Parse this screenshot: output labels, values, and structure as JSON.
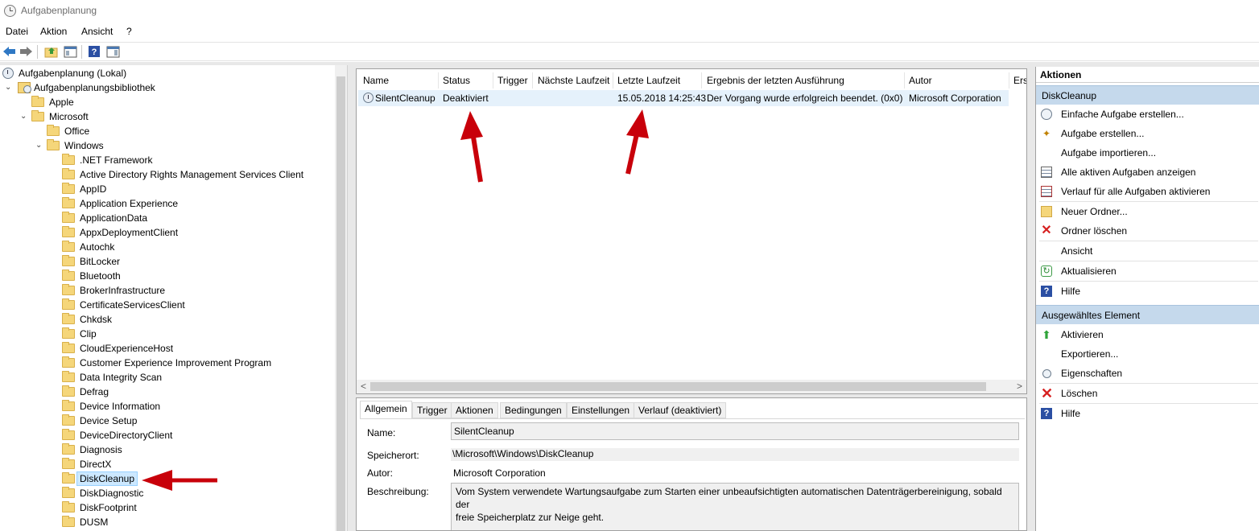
{
  "window": {
    "title": "Aufgabenplanung"
  },
  "menu": [
    "Datei",
    "Aktion",
    "Ansicht",
    "?"
  ],
  "toolbar": {
    "icons": [
      "back-icon",
      "forward-icon",
      "up-folder-icon",
      "console-tree-icon",
      "help-icon",
      "action-pane-icon"
    ]
  },
  "tree": {
    "root": "Aufgabenplanung (Lokal)",
    "library": "Aufgabenplanungsbibliothek",
    "apple": "Apple",
    "microsoft": "Microsoft",
    "office": "Office",
    "windows": "Windows",
    "windows_children": [
      ".NET Framework",
      "Active Directory Rights Management Services Client",
      "AppID",
      "Application Experience",
      "ApplicationData",
      "AppxDeploymentClient",
      "Autochk",
      "BitLocker",
      "Bluetooth",
      "BrokerInfrastructure",
      "CertificateServicesClient",
      "Chkdsk",
      "Clip",
      "CloudExperienceHost",
      "Customer Experience Improvement Program",
      "Data Integrity Scan",
      "Defrag",
      "Device Information",
      "Device Setup",
      "DeviceDirectoryClient",
      "Diagnosis",
      "DirectX",
      "DiskCleanup",
      "DiskDiagnostic",
      "DiskFootprint",
      "DUSM"
    ],
    "selected": "DiskCleanup"
  },
  "tasklist": {
    "columns": [
      "Name",
      "Status",
      "Trigger",
      "Nächste Laufzeit",
      "Letzte Laufzeit",
      "Ergebnis der letzten Ausführung",
      "Autor",
      "Ers"
    ],
    "row": {
      "name": "SilentCleanup",
      "status": "Deaktiviert",
      "trigger": "",
      "next_run": "",
      "last_run": "15.05.2018 14:25:43",
      "result": "Der Vorgang wurde erfolgreich beendet. (0x0)",
      "author": "Microsoft Corporation"
    }
  },
  "details": {
    "tabs": [
      "Allgemein",
      "Trigger",
      "Aktionen",
      "Bedingungen",
      "Einstellungen",
      "Verlauf (deaktiviert)"
    ],
    "active_tab": "Allgemein",
    "name_label": "Name:",
    "name_value": "SilentCleanup",
    "location_label": "Speicherort:",
    "location_value": "\\Microsoft\\Windows\\DiskCleanup",
    "author_label": "Autor:",
    "author_value": "Microsoft Corporation",
    "description_label": "Beschreibung:",
    "description_line1": "Vom System verwendete Wartungsaufgabe zum Starten einer unbeaufsichtigten automatischen Datenträgerbereinigung, sobald der",
    "description_line2": "freie Speicherplatz zur Neige geht."
  },
  "actions": {
    "header": "Aktionen",
    "section1": "DiskCleanup",
    "section1_items": [
      {
        "label": "Einfache Aufgabe erstellen...",
        "icon": "wizard-icon"
      },
      {
        "label": "Aufgabe erstellen...",
        "icon": "create-task-icon"
      },
      {
        "label": "Aufgabe importieren...",
        "icon": ""
      },
      {
        "label": "Alle aktiven Aufgaben anzeigen",
        "icon": "running-tasks-icon"
      },
      {
        "label": "Verlauf für alle Aufgaben aktivieren",
        "icon": "history-icon"
      },
      {
        "label": "Neuer Ordner...",
        "icon": "new-folder-icon"
      },
      {
        "label": "Ordner löschen",
        "icon": "delete-icon"
      },
      {
        "label": "Ansicht",
        "icon": ""
      },
      {
        "label": "Aktualisieren",
        "icon": "refresh-icon"
      },
      {
        "label": "Hilfe",
        "icon": "help-icon"
      }
    ],
    "section2": "Ausgewähltes Element",
    "section2_items": [
      {
        "label": "Aktivieren",
        "icon": "enable-icon"
      },
      {
        "label": "Exportieren...",
        "icon": ""
      },
      {
        "label": "Eigenschaften",
        "icon": "properties-icon"
      },
      {
        "label": "Löschen",
        "icon": "delete-icon"
      },
      {
        "label": "Hilfe",
        "icon": "help-icon"
      }
    ]
  },
  "colors": {
    "annotation_arrow": "#c8000a",
    "section_header": "#c5d9ec",
    "selection": "#cce8ff"
  }
}
